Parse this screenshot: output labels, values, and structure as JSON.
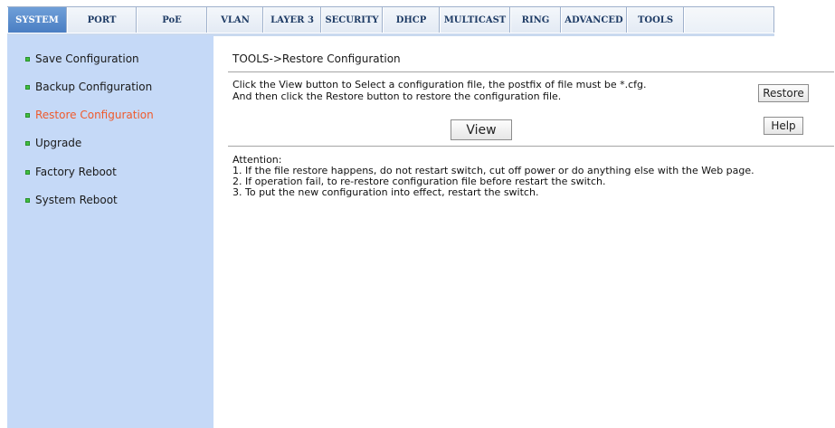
{
  "nav": {
    "tabs": [
      "SYSTEM",
      "PORT",
      "PoE",
      "VLAN",
      "LAYER 3",
      "SECURITY",
      "DHCP",
      "MULTICAST",
      "RING",
      "ADVANCED",
      "TOOLS"
    ],
    "active_tab": "SYSTEM"
  },
  "sidebar": {
    "items": [
      "Save Configuration",
      "Backup Configuration",
      "Restore Configuration",
      "Upgrade",
      "Factory Reboot",
      "System Reboot"
    ],
    "active_item": "Restore Configuration"
  },
  "main": {
    "title": "TOOLS->Restore Configuration",
    "description": [
      "Click the View button to Select a configuration file, the postfix of file must be *.cfg.",
      "And then click the Restore button to restore the configuration file."
    ],
    "restore_button": "Restore",
    "help_button": "Help",
    "view_button": "View",
    "attention_heading": "Attention:",
    "attention_items": [
      "1. If the file restore happens, do not restart switch, cut off power or do anything else with the Web page.",
      "2. If operation fail, to re-restore configuration file before restart the switch.",
      "3. To put the new configuration into effect, restart the switch."
    ]
  },
  "colors": {
    "active_tab": "#4a7ec3",
    "sidebar_bg": "#c5d9f7",
    "active_link": "#ef5b2d",
    "bullet": "#3fbf3f"
  }
}
